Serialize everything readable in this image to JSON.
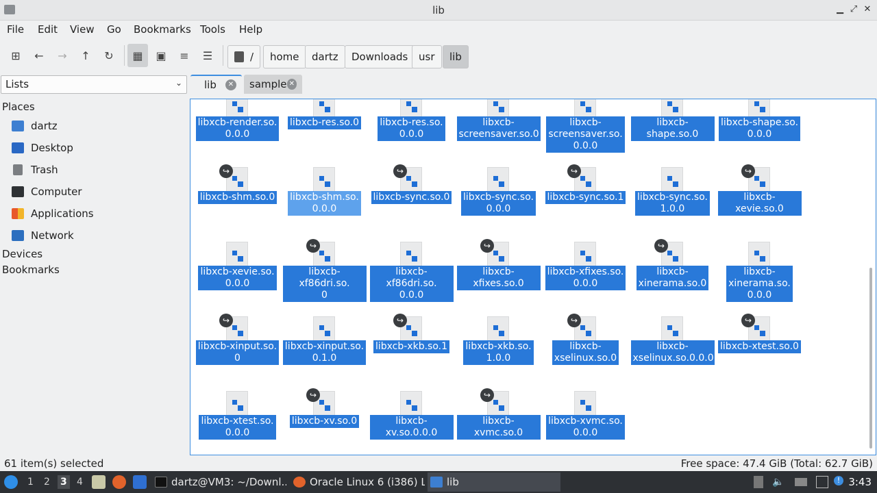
{
  "window": {
    "title": "lib"
  },
  "menu": [
    "File",
    "Edit",
    "View",
    "Go",
    "Bookmarks",
    "Tools",
    "Help"
  ],
  "breadcrumbs": [
    "/",
    "home",
    "dartz",
    "Downloads",
    "usr",
    "lib"
  ],
  "side_panel": {
    "mode": "Lists",
    "places_header": "Places",
    "places": [
      "dartz",
      "Desktop",
      "Trash",
      "Computer",
      "Applications",
      "Network"
    ],
    "devices_header": "Devices",
    "bookmarks_header": "Bookmarks"
  },
  "tabs": [
    "lib",
    "sample"
  ],
  "files": [
    {
      "name": "libxcb-render.so.\n0.0.0",
      "link": false
    },
    {
      "name": "libxcb-res.so.0",
      "link": false
    },
    {
      "name": "libxcb-res.so.\n0.0.0",
      "link": false
    },
    {
      "name": "libxcb-\nscreensaver.so.0",
      "link": false
    },
    {
      "name": "libxcb-\nscreensaver.so.\n0.0.0",
      "link": false
    },
    {
      "name": "libxcb-shape.so.0",
      "link": false
    },
    {
      "name": "libxcb-shape.so.\n0.0.0",
      "link": false
    },
    {
      "name": "libxcb-shm.so.0",
      "link": true
    },
    {
      "name": "libxcb-shm.so.\n0.0.0",
      "link": false
    },
    {
      "name": "libxcb-sync.so.0",
      "link": true
    },
    {
      "name": "libxcb-sync.so.\n0.0.0",
      "link": false
    },
    {
      "name": "libxcb-sync.so.1",
      "link": true
    },
    {
      "name": "libxcb-sync.so.\n1.0.0",
      "link": false
    },
    {
      "name": "libxcb-xevie.so.0",
      "link": true
    },
    {
      "name": "libxcb-xevie.so.\n0.0.0",
      "link": false
    },
    {
      "name": "libxcb-xf86dri.so.\n0",
      "link": true
    },
    {
      "name": "libxcb-xf86dri.so.\n0.0.0",
      "link": false
    },
    {
      "name": "libxcb-xfixes.so.0",
      "link": true
    },
    {
      "name": "libxcb-xfixes.so.\n0.0.0",
      "link": false
    },
    {
      "name": "libxcb-\nxinerama.so.0",
      "link": true
    },
    {
      "name": "libxcb-\nxinerama.so.\n0.0.0",
      "link": false
    },
    {
      "name": "libxcb-xinput.so.\n0",
      "link": true
    },
    {
      "name": "libxcb-xinput.so.\n0.1.0",
      "link": false
    },
    {
      "name": "libxcb-xkb.so.1",
      "link": true
    },
    {
      "name": "libxcb-xkb.so.\n1.0.0",
      "link": false
    },
    {
      "name": "libxcb-\nxselinux.so.0",
      "link": true
    },
    {
      "name": "libxcb-\nxselinux.so.0.0.0",
      "link": false
    },
    {
      "name": "libxcb-xtest.so.0",
      "link": true
    },
    {
      "name": "libxcb-xtest.so.\n0.0.0",
      "link": false
    },
    {
      "name": "libxcb-xv.so.0",
      "link": true
    },
    {
      "name": "libxcb-xv.so.0.0.0",
      "link": false
    },
    {
      "name": "libxcb-xvmc.so.0",
      "link": true
    },
    {
      "name": "libxcb-xvmc.so.\n0.0.0",
      "link": false
    }
  ],
  "status": {
    "selection": "61 item(s) selected",
    "free_space": "Free space: 47.4 GiB (Total: 62.7 GiB)"
  },
  "taskbar": {
    "workspaces": [
      "1",
      "2",
      "3",
      "4"
    ],
    "current_workspace": "3",
    "tasks": [
      "dartz@VM3: ~/Downl...",
      "Oracle Linux 6 (i386) L...",
      "lib"
    ],
    "clock": "3:43"
  },
  "colors": {
    "selection": "#2979d9",
    "accent": "#3d8ee0",
    "taskbar": "#2d3034"
  }
}
